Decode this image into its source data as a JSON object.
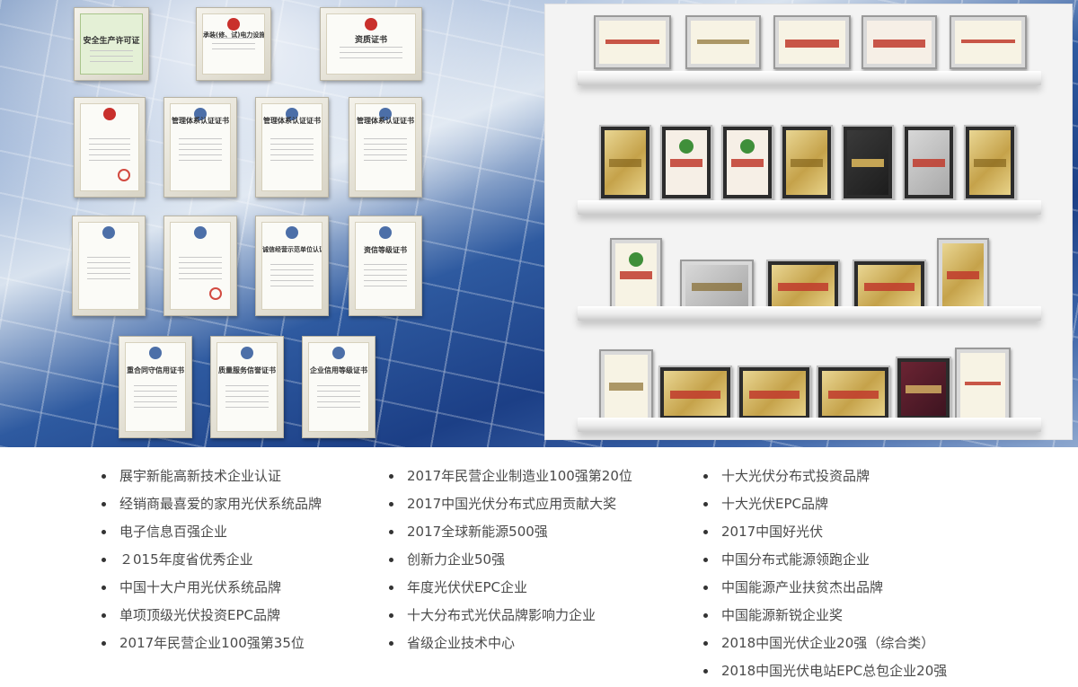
{
  "honors": {
    "column_1": [
      "展宇新能高新技术企业认证",
      "经销商最喜爱的家用光伏系统品牌",
      "电子信息百强企业",
      "２015年度省优秀企业",
      "中国十大户用光伏系统品牌",
      "单项顶级光伏投资EPC品牌",
      "2017年民营企业100强第35位"
    ],
    "column_2": [
      "2017年民营企业制造业100强第20位",
      "2017中国光伏分布式应用贡献大奖",
      "2017全球新能源500强",
      "创新力企业50强",
      "年度光伏伏EPC企业",
      "十大分布式光伏品牌影响力企业",
      "省级企业技术中心"
    ],
    "column_3": [
      "十大光伏分布式投资品牌",
      "十大光伏EPC品牌",
      "2017中国好光伏",
      "中国分布式能源领跑企业",
      "中国能源产业扶贫杰出品牌",
      "中国能源新锐企业奖",
      "2018中国光伏企业20强（综合类）",
      "2018中国光伏电站EPC总包企业20强"
    ]
  },
  "certificates": {
    "row_1": [
      "安全生产许可证",
      "承装(修、试)电力设施许可证",
      "资质证书"
    ],
    "row_2": [
      "",
      "管理体系认证证书",
      "管理体系认证证书",
      "管理体系认证证书"
    ],
    "row_3": [
      "",
      "",
      "诚信经营示范单位认证书",
      "资信等级证书"
    ],
    "row_4": [
      "重合同守信用证书",
      "质量服务信誉证书",
      "企业信用等级证书"
    ]
  },
  "colors": {
    "bullet": "#333333",
    "text": "#4a4a4a",
    "award_red": "#c0392b",
    "award_gold": "#c5a24a"
  }
}
